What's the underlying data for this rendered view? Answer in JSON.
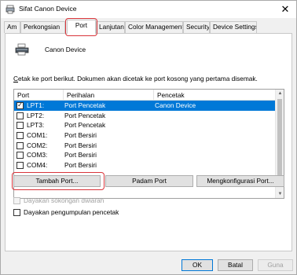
{
  "window": {
    "title": "Sifat Canon Device",
    "close_glyph": "✕"
  },
  "tabs": [
    {
      "label": "Am"
    },
    {
      "label": "Perkongsian"
    },
    {
      "label": "Port"
    },
    {
      "label": "Lanjutan"
    },
    {
      "label": "Color Management"
    },
    {
      "label": "Security"
    },
    {
      "label": "Device Settings"
    }
  ],
  "active_tab": "Port",
  "printer": {
    "name": "Canon Device",
    "icon": "printer-icon"
  },
  "instructions": {
    "underlined": "C",
    "text": "etak ke port berikut. Dokumen akan dicetak ke port kosong yang pertama disemak."
  },
  "port_table": {
    "headers": [
      "Port",
      "Perihalan",
      "Pencetak"
    ],
    "rows": [
      {
        "port": "LPT1:",
        "description": "Port Pencetak",
        "printer": "Canon Device",
        "checked": true,
        "selected": true
      },
      {
        "port": "LPT2:",
        "description": "Port Pencetak",
        "printer": "",
        "checked": false,
        "selected": false
      },
      {
        "port": "LPT3:",
        "description": "Port Pencetak",
        "printer": "",
        "checked": false,
        "selected": false
      },
      {
        "port": "COM1:",
        "description": "Port Bersiri",
        "printer": "",
        "checked": false,
        "selected": false
      },
      {
        "port": "COM2:",
        "description": "Port Bersiri",
        "printer": "",
        "checked": false,
        "selected": false
      },
      {
        "port": "COM3:",
        "description": "Port Bersiri",
        "printer": "",
        "checked": false,
        "selected": false
      },
      {
        "port": "COM4:",
        "description": "Port Bersiri",
        "printer": "",
        "checked": false,
        "selected": false
      }
    ]
  },
  "buttons": {
    "add_port": "Tambah Port...",
    "delete_port": "Padam Port",
    "configure_port": "Mengkonfigurasi Port..."
  },
  "options": {
    "bidirectional": {
      "label": "Dayakan sokongan dwiarah",
      "checked": false,
      "enabled": false
    },
    "pooling": {
      "label": "Dayakan pengumpulan pencetak",
      "checked": false,
      "enabled": true
    }
  },
  "footer": {
    "ok": "OK",
    "cancel": "Batal",
    "apply": "Guna"
  },
  "colors": {
    "highlight": "#d9343a",
    "selection": "#0078d7"
  }
}
